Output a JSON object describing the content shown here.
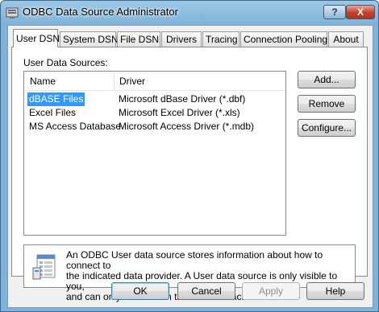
{
  "window": {
    "title": "ODBC Data Source Administrator",
    "help_glyph": "?",
    "close_glyph": "X"
  },
  "tabs": [
    {
      "label": "User DSN",
      "active": true
    },
    {
      "label": "System DSN"
    },
    {
      "label": "File DSN"
    },
    {
      "label": "Drivers"
    },
    {
      "label": "Tracing"
    },
    {
      "label": "Connection Pooling"
    },
    {
      "label": "About"
    }
  ],
  "user_dsn": {
    "list_label": "User Data Sources:",
    "columns": [
      "Name",
      "Driver"
    ],
    "rows": [
      {
        "name": "dBASE Files",
        "driver": "Microsoft dBase Driver (*.dbf)",
        "selected": true
      },
      {
        "name": "Excel Files",
        "driver": "Microsoft Excel Driver (*.xls)"
      },
      {
        "name": "MS Access Database",
        "driver": "Microsoft Access Driver (*.mdb)"
      }
    ],
    "buttons": {
      "add": "Add...",
      "remove": "Remove",
      "configure": "Configure..."
    },
    "info": {
      "line1": "An ODBC User data source stores information about how to connect to",
      "line2": "the indicated data provider.  A User data source is only visible to you,",
      "line3": "and can only be used on the current machine."
    }
  },
  "footer": {
    "ok": "OK",
    "cancel": "Cancel",
    "apply": "Apply",
    "help": "Help"
  },
  "colors": {
    "selection": "#3399ff",
    "frame": "#7fb2d8",
    "close": "#c4402b"
  }
}
